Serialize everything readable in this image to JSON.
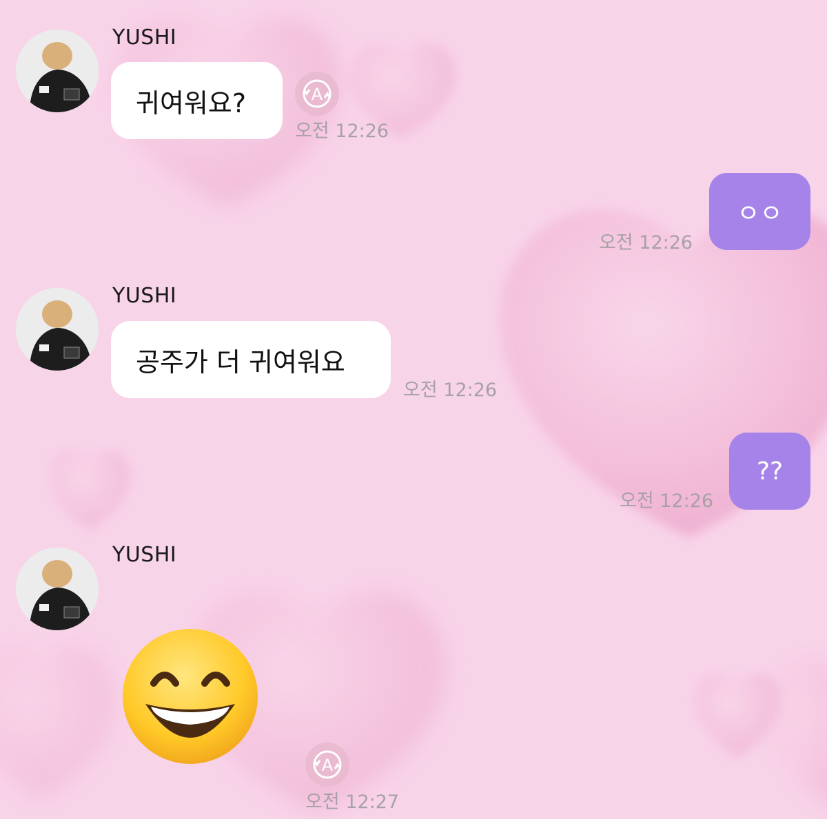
{
  "chat": {
    "messages": [
      {
        "sender": "YUSHI",
        "text": "귀여워요?",
        "time": "오전 12:26",
        "translate_icon": "translate-icon"
      },
      {
        "self": true,
        "text": "ㅇㅇ",
        "time": "오전 12:26"
      },
      {
        "sender": "YUSHI",
        "text": "공주가 더 귀여워요",
        "time": "오전 12:26"
      },
      {
        "self": true,
        "text": "??",
        "time": "오전 12:26"
      },
      {
        "sender": "YUSHI",
        "emoji": "grinning-face-with-smiling-eyes",
        "time": "오전 12:27",
        "translate_icon": "translate-icon"
      }
    ]
  },
  "colors": {
    "background": "#f7d3e8",
    "incoming_bubble": "#ffffff",
    "outgoing_bubble": "#a583e8",
    "timestamp": "#a7a1a6"
  }
}
